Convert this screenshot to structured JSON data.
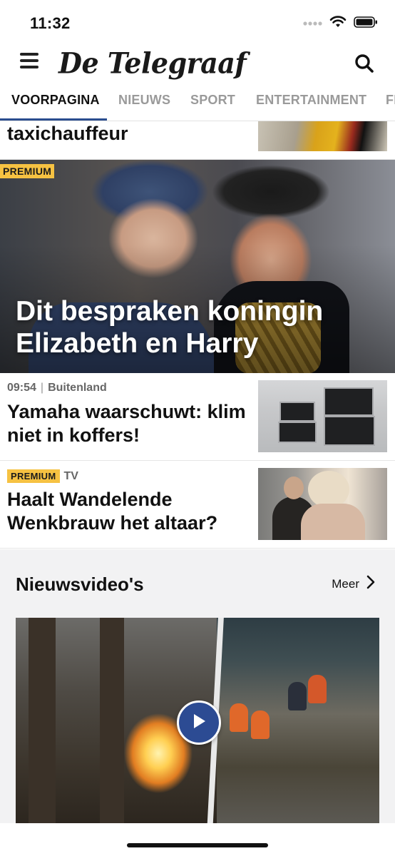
{
  "status_bar": {
    "time": "11:32"
  },
  "app_bar": {
    "logo_text": "De Telegraaf"
  },
  "tabs": [
    {
      "label": "VOORPAGINA",
      "active": true
    },
    {
      "label": "NIEUWS",
      "active": false
    },
    {
      "label": "SPORT",
      "active": false
    },
    {
      "label": "ENTERTAINMENT",
      "active": false
    },
    {
      "label": "FI",
      "active": false
    }
  ],
  "top_story": {
    "title": "taxichauffeur"
  },
  "hero": {
    "badge": "PREMIUM",
    "title": "Dit bespraken koningin Elizabeth en Harry"
  },
  "articles": [
    {
      "time": "09:54",
      "separator": "|",
      "section": "Buitenland",
      "headline": "Yamaha waarschuwt: klim niet in koffers!",
      "premium": false
    },
    {
      "badge": "PREMIUM",
      "section": "TV",
      "headline": "Haalt Wandelende Wenkbrauw het altaar?",
      "premium": true
    }
  ],
  "videos": {
    "title": "Nieuwsvideo's",
    "more_label": "Meer"
  },
  "colors": {
    "accent": "#2a4d8f",
    "premium": "#f6c242",
    "play_button": "#2c4b93"
  }
}
